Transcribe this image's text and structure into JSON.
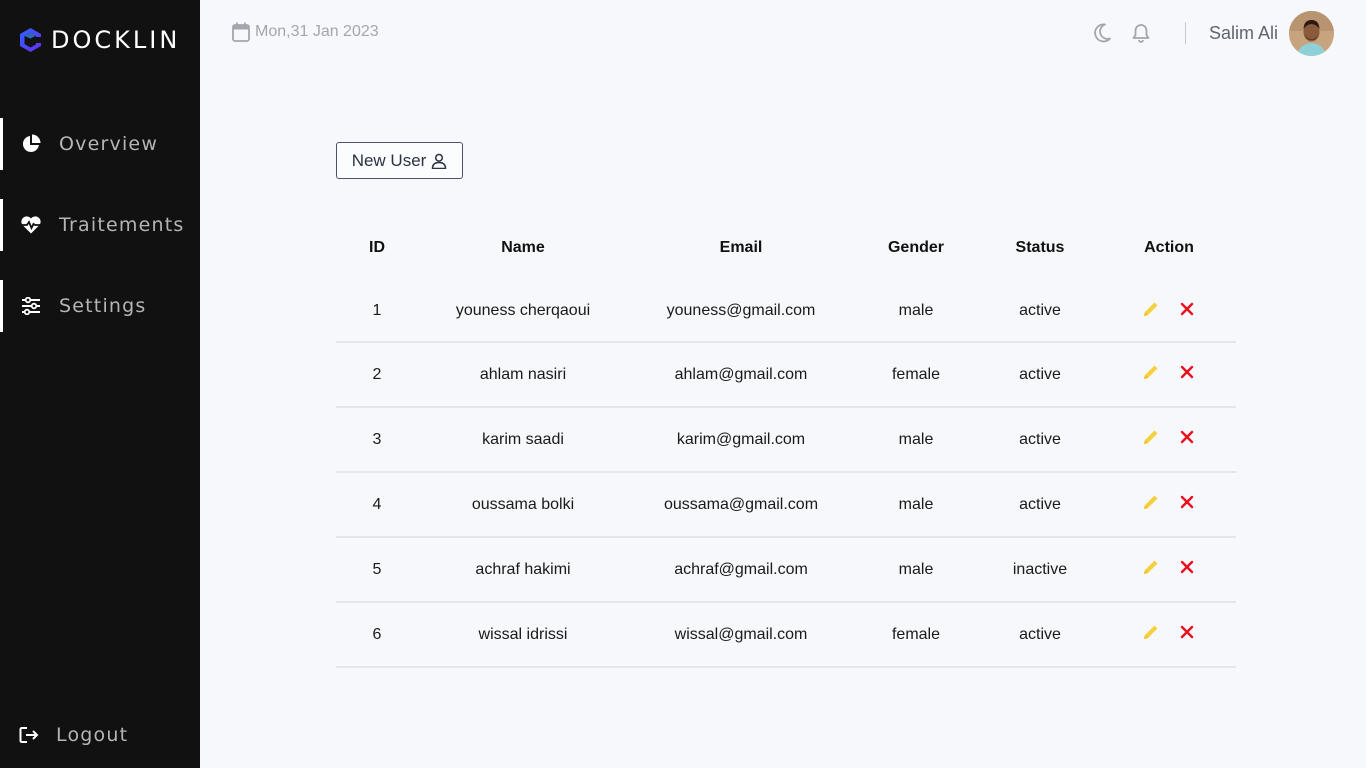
{
  "brand": {
    "name": "DOCKLIN",
    "icon": "docklin-logo-icon"
  },
  "sidebar": {
    "items": [
      {
        "label": "Overview",
        "icon": "pie-chart-icon"
      },
      {
        "label": "Traitements",
        "icon": "heart-pulse-icon"
      },
      {
        "label": "Settings",
        "icon": "sliders-icon"
      }
    ],
    "logout": {
      "label": "Logout",
      "icon": "logout-icon"
    }
  },
  "header": {
    "date": "Mon,31 Jan 2023",
    "user_name": "Salim Ali",
    "icons": [
      "moon-icon",
      "bell-icon"
    ]
  },
  "main": {
    "new_user_label": "New User",
    "table": {
      "columns": [
        "ID",
        "Name",
        "Email",
        "Gender",
        "Status",
        "Action"
      ],
      "rows": [
        {
          "id": "1",
          "name": "youness cherqaoui",
          "email": "youness@gmail.com",
          "gender": "male",
          "status": "active"
        },
        {
          "id": "2",
          "name": "ahlam nasiri",
          "email": "ahlam@gmail.com",
          "gender": "female",
          "status": "active"
        },
        {
          "id": "3",
          "name": "karim saadi",
          "email": "karim@gmail.com",
          "gender": "male",
          "status": "active"
        },
        {
          "id": "4",
          "name": "oussama bolki",
          "email": "oussama@gmail.com",
          "gender": "male",
          "status": "active"
        },
        {
          "id": "5",
          "name": "achraf hakimi",
          "email": "achraf@gmail.com",
          "gender": "male",
          "status": "inactive"
        },
        {
          "id": "6",
          "name": "wissal idrissi",
          "email": "wissal@gmail.com",
          "gender": "female",
          "status": "active"
        }
      ]
    }
  },
  "colors": {
    "sidebar_bg": "#111111",
    "page_bg": "#f7f8fc",
    "edit_icon": "#f5d142",
    "delete_icon": "#e8101c",
    "brand_blue": "#1f5eff",
    "brand_purple": "#6a2bf0"
  }
}
